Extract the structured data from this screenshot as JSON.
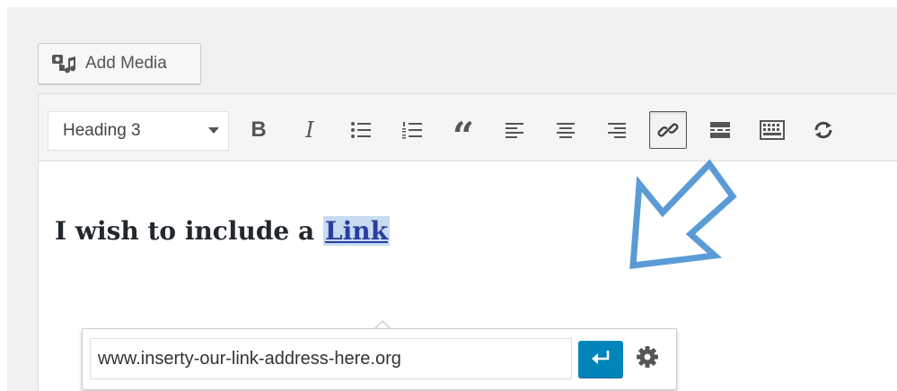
{
  "add_media": {
    "label": "Add Media",
    "icon": "media-icon"
  },
  "toolbar": {
    "format_select": {
      "value": "Heading 3"
    },
    "buttons": [
      {
        "name": "bold-button",
        "glyph": "B",
        "icon": "bold-icon"
      },
      {
        "name": "italic-button",
        "glyph": "I",
        "icon": "italic-icon"
      },
      {
        "name": "bullet-list-button",
        "icon": "bullet-list-icon"
      },
      {
        "name": "numbered-list-button",
        "icon": "numbered-list-icon"
      },
      {
        "name": "blockquote-button",
        "glyph": "“",
        "icon": "blockquote-icon"
      },
      {
        "name": "align-left-button",
        "icon": "align-left-icon"
      },
      {
        "name": "align-center-button",
        "icon": "align-center-icon"
      },
      {
        "name": "align-right-button",
        "icon": "align-right-icon"
      },
      {
        "name": "insert-link-button",
        "icon": "link-icon",
        "active": true
      },
      {
        "name": "read-more-button",
        "icon": "read-more-icon"
      },
      {
        "name": "toolbar-toggle-button",
        "icon": "keyboard-icon"
      },
      {
        "name": "refresh-button",
        "icon": "refresh-icon"
      }
    ]
  },
  "content": {
    "heading_text": "I wish to include a ",
    "heading_link": "Link"
  },
  "link_popover": {
    "url_value": "www.inserty-our-link-address-here.org",
    "apply_icon": "enter-icon",
    "settings_icon": "gear-icon"
  },
  "colors": {
    "accent": "#0085ba",
    "annotation_arrow": "#5b9bd5",
    "link_highlight": "#c8dbf1"
  }
}
